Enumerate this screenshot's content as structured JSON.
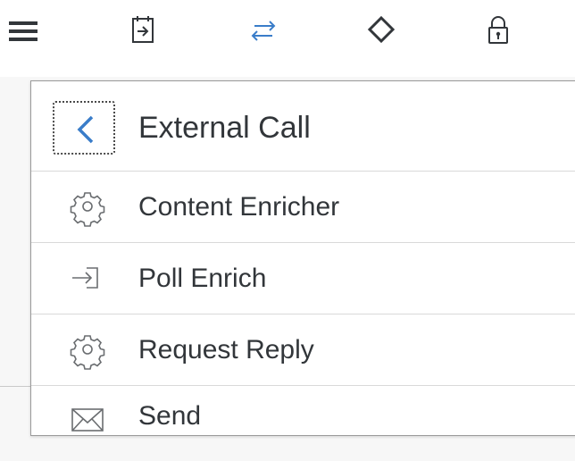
{
  "colors": {
    "accent": "#3a7dc9",
    "icon_dark": "#32363a",
    "icon_grey": "#6a6d70",
    "divider": "#d9d9d9",
    "border": "#9a9a9a"
  },
  "toolbar": {
    "icons": [
      "menu-icon",
      "event-icon",
      "transfer-icon",
      "gateway-icon",
      "security-icon"
    ]
  },
  "menu": {
    "back_icon": "chevron-left-icon",
    "title": "External Call",
    "items": [
      {
        "label": "Content Enricher",
        "icon": "gear-icon"
      },
      {
        "label": "Poll Enrich",
        "icon": "import-icon"
      },
      {
        "label": "Request Reply",
        "icon": "gear-icon"
      },
      {
        "label": "Send",
        "icon": "envelope-icon"
      }
    ]
  }
}
